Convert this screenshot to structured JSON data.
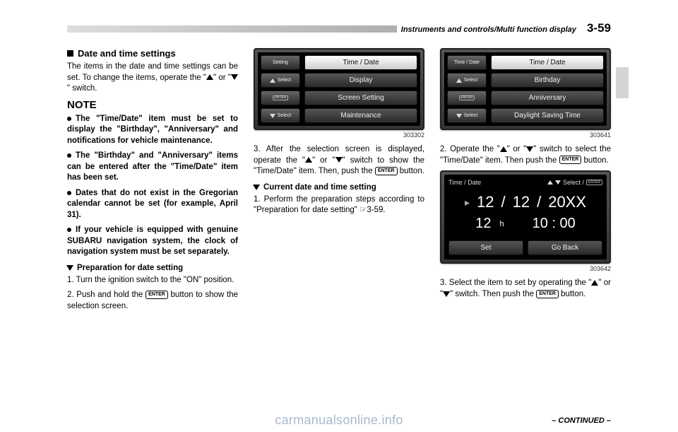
{
  "header": {
    "breadcrumb": "Instruments and controls/Multi function display",
    "pagenum": "3-59"
  },
  "col1": {
    "section_title": "Date and time settings",
    "intro": "The items in the date and time settings can be set. To change the items, operate the \"\" or \"\" switch.",
    "intro_pre": "The items in the date and time settings can be set. To change the items, operate the \"",
    "intro_mid": "\" or \"",
    "intro_post": "\" switch.",
    "note_label": "NOTE",
    "b1": "The \"Time/Date\" item must be set to display the \"Birthday\", \"Anniversary\" and notifications for vehicle maintenance.",
    "b2": "The \"Birthday\" and \"Anniversary\" items can be entered after the \"Time/Date\" item has been set.",
    "b3": "Dates that do not exist in the Gregorian calendar cannot be set (for example, April 31).",
    "b4": "If your vehicle is equipped with genuine SUBARU navigation system, the clock of navigation system must be set separately.",
    "prep_heading": "Preparation for date setting",
    "step1": "1.  Turn the ignition switch to the \"ON\" position.",
    "step2_pre": "2.  Push and hold the ",
    "step2_post": " button to show the selection screen.",
    "enter_label": "ENTER"
  },
  "col2": {
    "device1": {
      "left": {
        "setting": "Setting",
        "select_up": "Select",
        "enter": "ENTER",
        "select_down": "Select"
      },
      "items": [
        "Time / Date",
        "Display",
        "Screen Setting",
        "Maintenance"
      ]
    },
    "figref1": "303302",
    "p1_pre": "3.  After the selection screen is displayed, operate the \"",
    "p1_mid": "\" or \"",
    "p1_mid2": "\" switch to show the \"Time/Date\" item. Then, push the ",
    "p1_post": " button.",
    "sub_heading": "Current date and time setting",
    "p2": "1.  Perform the preparation steps according to \"Preparation for date setting\" ☞3-59."
  },
  "col3": {
    "device2": {
      "left": {
        "setting": "Time / Date",
        "select_up": "Select",
        "enter": "ENTER",
        "select_down": "Select"
      },
      "items": [
        "Time / Date",
        "Birthday",
        "Anniversary",
        "Daylight Saving Time"
      ]
    },
    "figref2": "303641",
    "p1_pre": "2.  Operate the \"",
    "p1_mid": "\" or \"",
    "p1_mid2": "\" switch to select the \"Time/Date\" item. Then push the ",
    "p1_post": " button.",
    "device3": {
      "top_left": "Time / Date",
      "top_select": "Select /",
      "month": "12",
      "day": "12",
      "year": "20XX",
      "hour": "12",
      "h_unit": "h",
      "minute": "10 : 00",
      "set": "Set",
      "goback": "Go Back"
    },
    "figref3": "303642",
    "p2_pre": "3.  Select the item to set by operating the \"",
    "p2_mid": "\" or \"",
    "p2_mid2": "\" switch. Then push the ",
    "p2_post": " button."
  },
  "continued": "– CONTINUED –",
  "watermark": "carmanualsonline.info"
}
